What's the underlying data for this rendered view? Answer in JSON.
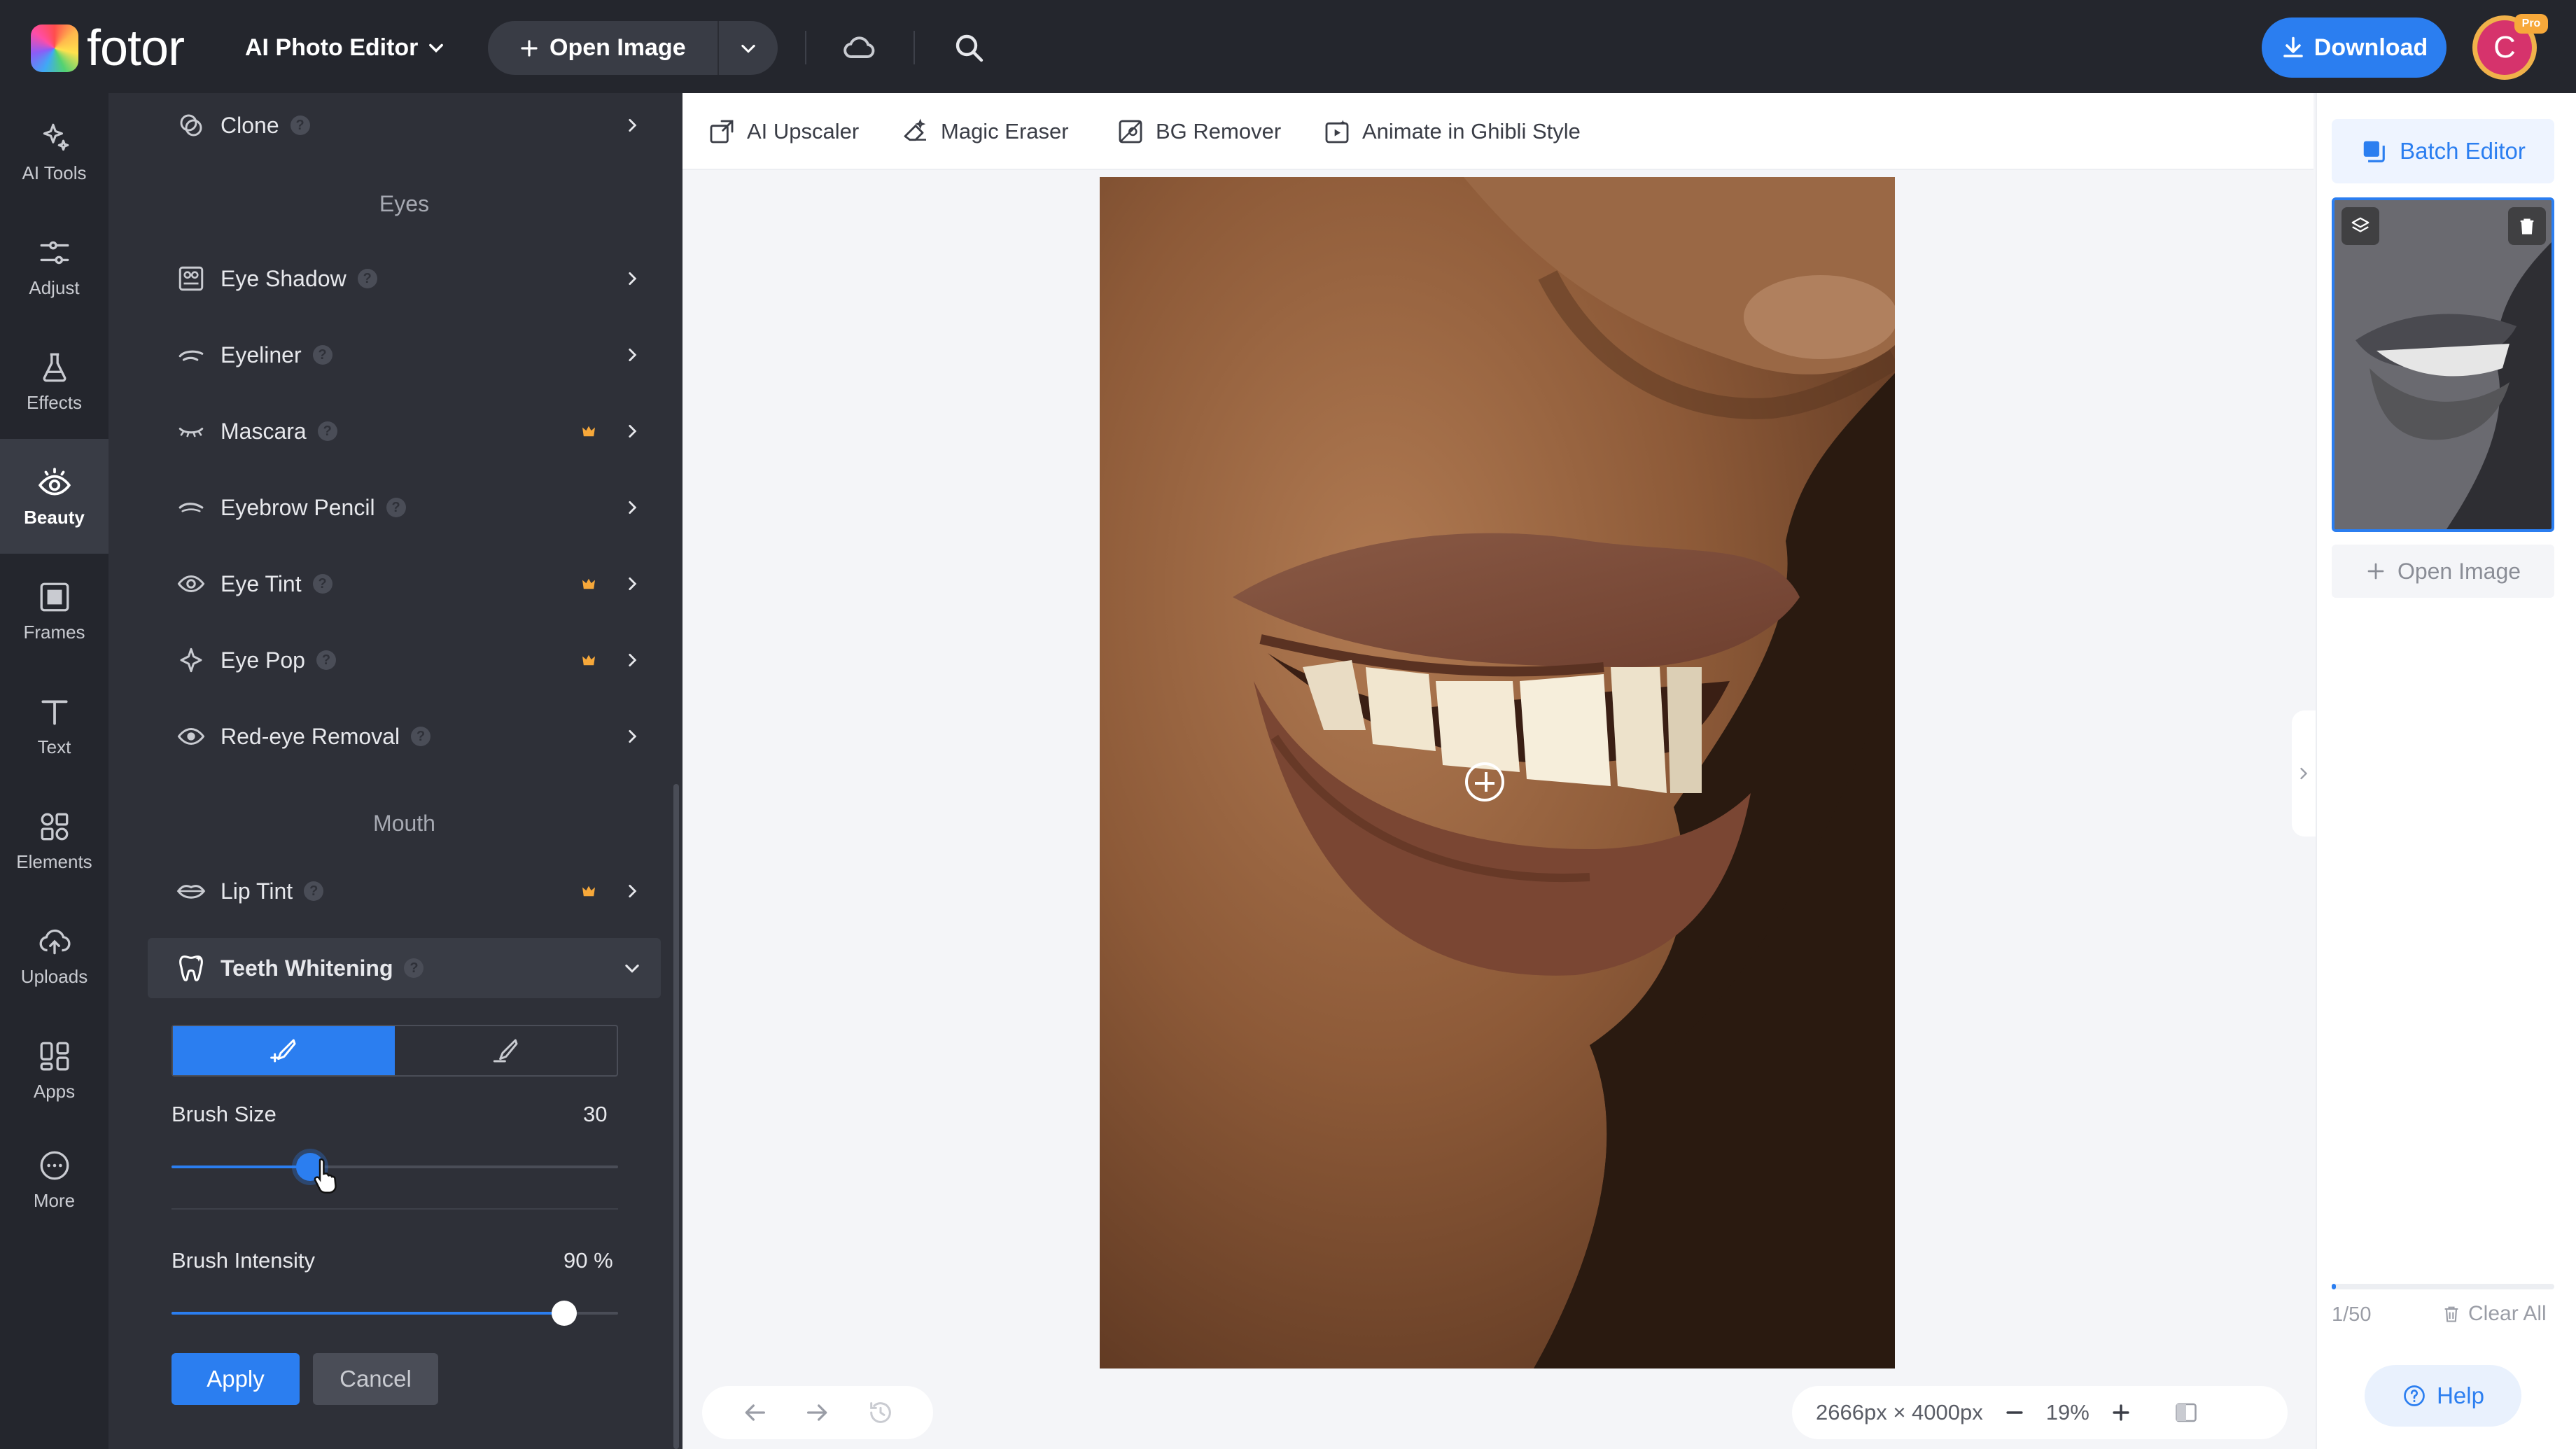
{
  "topbar": {
    "logo_text": "fotor",
    "editor_menu_label": "AI Photo Editor",
    "open_image_label": "Open Image",
    "download_label": "Download",
    "avatar_letter": "C",
    "pro_badge": "Pro"
  },
  "rail": {
    "items": [
      {
        "label": "AI Tools",
        "icon": "sparkle-icon"
      },
      {
        "label": "Adjust",
        "icon": "sliders-icon"
      },
      {
        "label": "Effects",
        "icon": "flask-icon"
      },
      {
        "label": "Beauty",
        "icon": "eye-icon",
        "active": true
      },
      {
        "label": "Frames",
        "icon": "frame-icon"
      },
      {
        "label": "Text",
        "icon": "text-icon"
      },
      {
        "label": "Elements",
        "icon": "shapes-icon"
      },
      {
        "label": "Uploads",
        "icon": "cloud-upload-icon"
      },
      {
        "label": "Apps",
        "icon": "apps-icon"
      },
      {
        "label": "More",
        "icon": "more-icon"
      }
    ]
  },
  "panel": {
    "clone": "Clone",
    "section_eyes": "Eyes",
    "eye_shadow": "Eye Shadow",
    "eyeliner": "Eyeliner",
    "mascara": "Mascara",
    "eyebrow_pencil": "Eyebrow Pencil",
    "eye_tint": "Eye Tint",
    "eye_pop": "Eye Pop",
    "red_eye": "Red-eye Removal",
    "section_mouth": "Mouth",
    "lip_tint": "Lip Tint",
    "teeth_whitening": "Teeth Whitening",
    "brush_size_label": "Brush Size",
    "brush_size_value": "30",
    "brush_size_fraction": 0.31,
    "brush_intensity_label": "Brush Intensity",
    "brush_intensity_value": "90 %",
    "brush_intensity_fraction": 0.88,
    "apply_label": "Apply",
    "cancel_label": "Cancel"
  },
  "toolbar": {
    "ai_upscaler": "AI Upscaler",
    "magic_eraser": "Magic Eraser",
    "bg_remover": "BG Remover",
    "ghibli": "Animate in Ghibli Style"
  },
  "canvas": {
    "dimensions": "2666px × 4000px",
    "zoom": "19%"
  },
  "right": {
    "batch_editor": "Batch Editor",
    "open_image": "Open Image",
    "counter": "1/50",
    "clear_all": "Clear All",
    "help": "Help"
  },
  "colors": {
    "accent": "#2b7ef0",
    "topbar_bg": "#24262d",
    "panel_bg": "#2e3038",
    "premium": "#f7a83a"
  }
}
